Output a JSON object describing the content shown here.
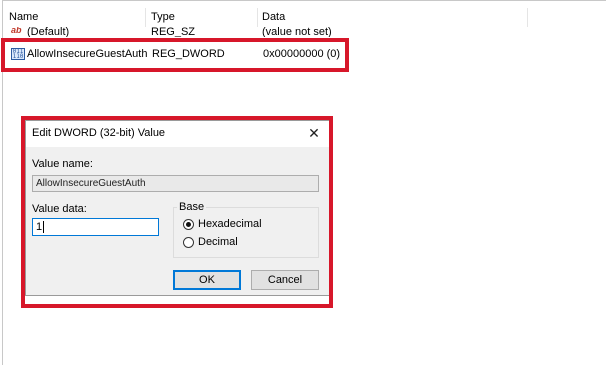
{
  "columns": {
    "name": "Name",
    "type": "Type",
    "data": "Data"
  },
  "rows": [
    {
      "name": "(Default)",
      "type": "REG_SZ",
      "data": "(value not set)",
      "icon": "string-value-icon"
    },
    {
      "name": "AllowInsecureGuestAuth",
      "type": "REG_DWORD",
      "data": "0x00000000 (0)",
      "icon": "binary-value-icon"
    }
  ],
  "dialog": {
    "title": "Edit DWORD (32-bit) Value",
    "close_glyph": "✕",
    "value_name_label": "Value name:",
    "value_name": "AllowInsecureGuestAuth",
    "value_data_label": "Value data:",
    "value_data": "1",
    "base_label": "Base",
    "base_options": [
      {
        "label": "Hexadecimal",
        "selected": true
      },
      {
        "label": "Decimal",
        "selected": false
      }
    ],
    "ok_label": "OK",
    "cancel_label": "Cancel"
  },
  "icons": {
    "string": "ab",
    "binary": "011 110"
  },
  "colors": {
    "highlight": "#d7172a",
    "focus": "#0078d7"
  }
}
